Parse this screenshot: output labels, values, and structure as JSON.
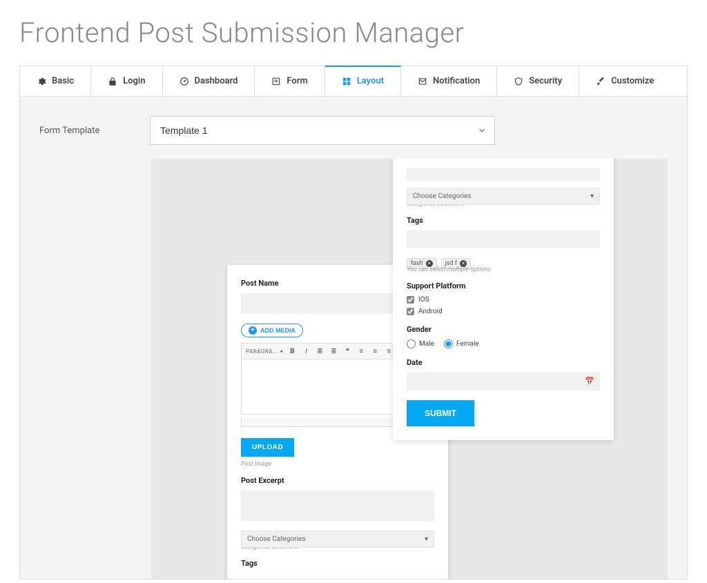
{
  "title": "Frontend Post Submission Manager",
  "tabs": [
    {
      "label": "Basic"
    },
    {
      "label": "Login"
    },
    {
      "label": "Dashboard"
    },
    {
      "label": "Form"
    },
    {
      "label": "Layout",
      "active": true
    },
    {
      "label": "Notification"
    },
    {
      "label": "Security"
    },
    {
      "label": "Customize"
    }
  ],
  "form_template_label": "Form Template",
  "form_template_value": "Template 1",
  "card_a": {
    "post_name_label": "Post Name",
    "add_media": "ADD MEDIA",
    "paragraph": "PARAGRA...",
    "upload": "UPLOAD",
    "post_image_hint": "Post Image",
    "post_excerpt_label": "Post Excerpt",
    "choose_categories": "Choose Categories",
    "categories_hint": "Categories select box",
    "tags_label": "Tags"
  },
  "card_b": {
    "choose_categories": "Choose Categories",
    "categories_hint": "Categories select box",
    "tags_label": "Tags",
    "chips": [
      "fash",
      "jsd f"
    ],
    "tags_hint": "You can select multiple options",
    "support_platform_label": "Support Platform",
    "ios": "IOS",
    "android": "Android",
    "gender_label": "Gender",
    "male": "Male",
    "female": "Female",
    "date_label": "Date",
    "submit": "SUBMIT"
  }
}
